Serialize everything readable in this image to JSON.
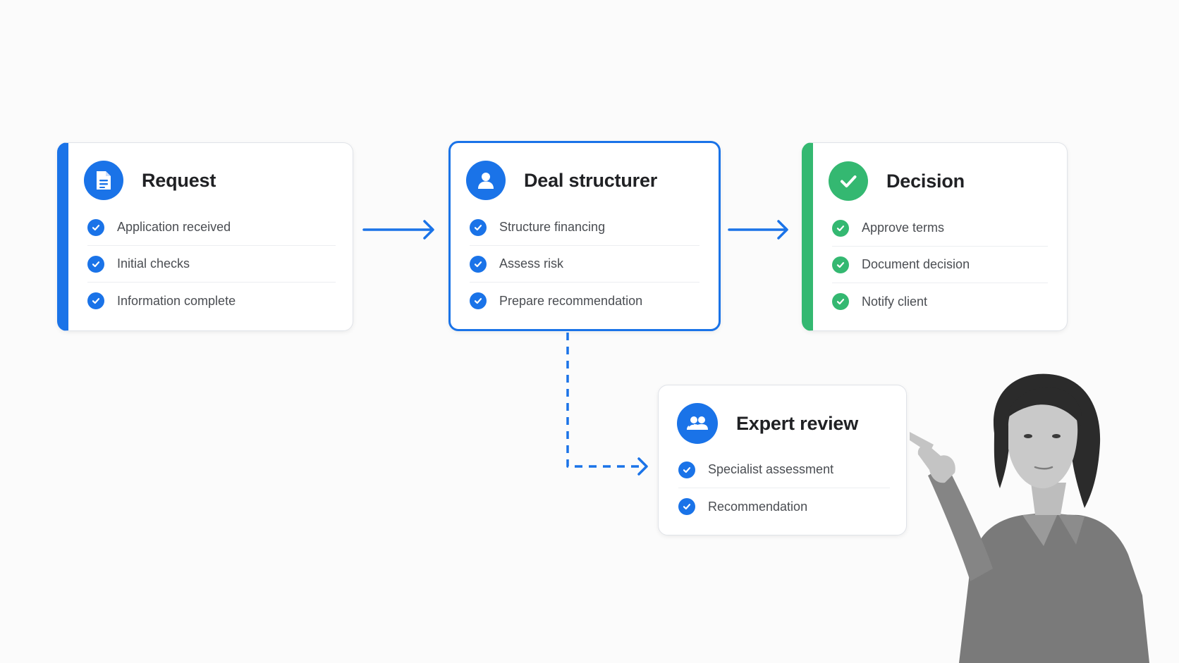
{
  "steps": {
    "request": {
      "title": "Request",
      "icon": "document-icon",
      "items": [
        "Application received",
        "Initial checks",
        "Information complete"
      ]
    },
    "deal_structurer": {
      "title": "Deal structurer",
      "icon": "person-icon",
      "items": [
        "Structure financing",
        "Assess risk",
        "Prepare recommendation"
      ]
    },
    "decision": {
      "title": "Decision",
      "icon": "checkmark-icon",
      "items": [
        "Approve terms",
        "Document decision",
        "Notify client"
      ]
    },
    "expert_review": {
      "title": "Expert review",
      "icon": "people-icon",
      "items": [
        "Specialist assessment",
        "Recommendation"
      ]
    }
  },
  "colors": {
    "blue": "#1a73e8",
    "green": "#34b871",
    "border": "#e0e3e8",
    "text": "#202124",
    "muted_text": "#4a4d52"
  }
}
